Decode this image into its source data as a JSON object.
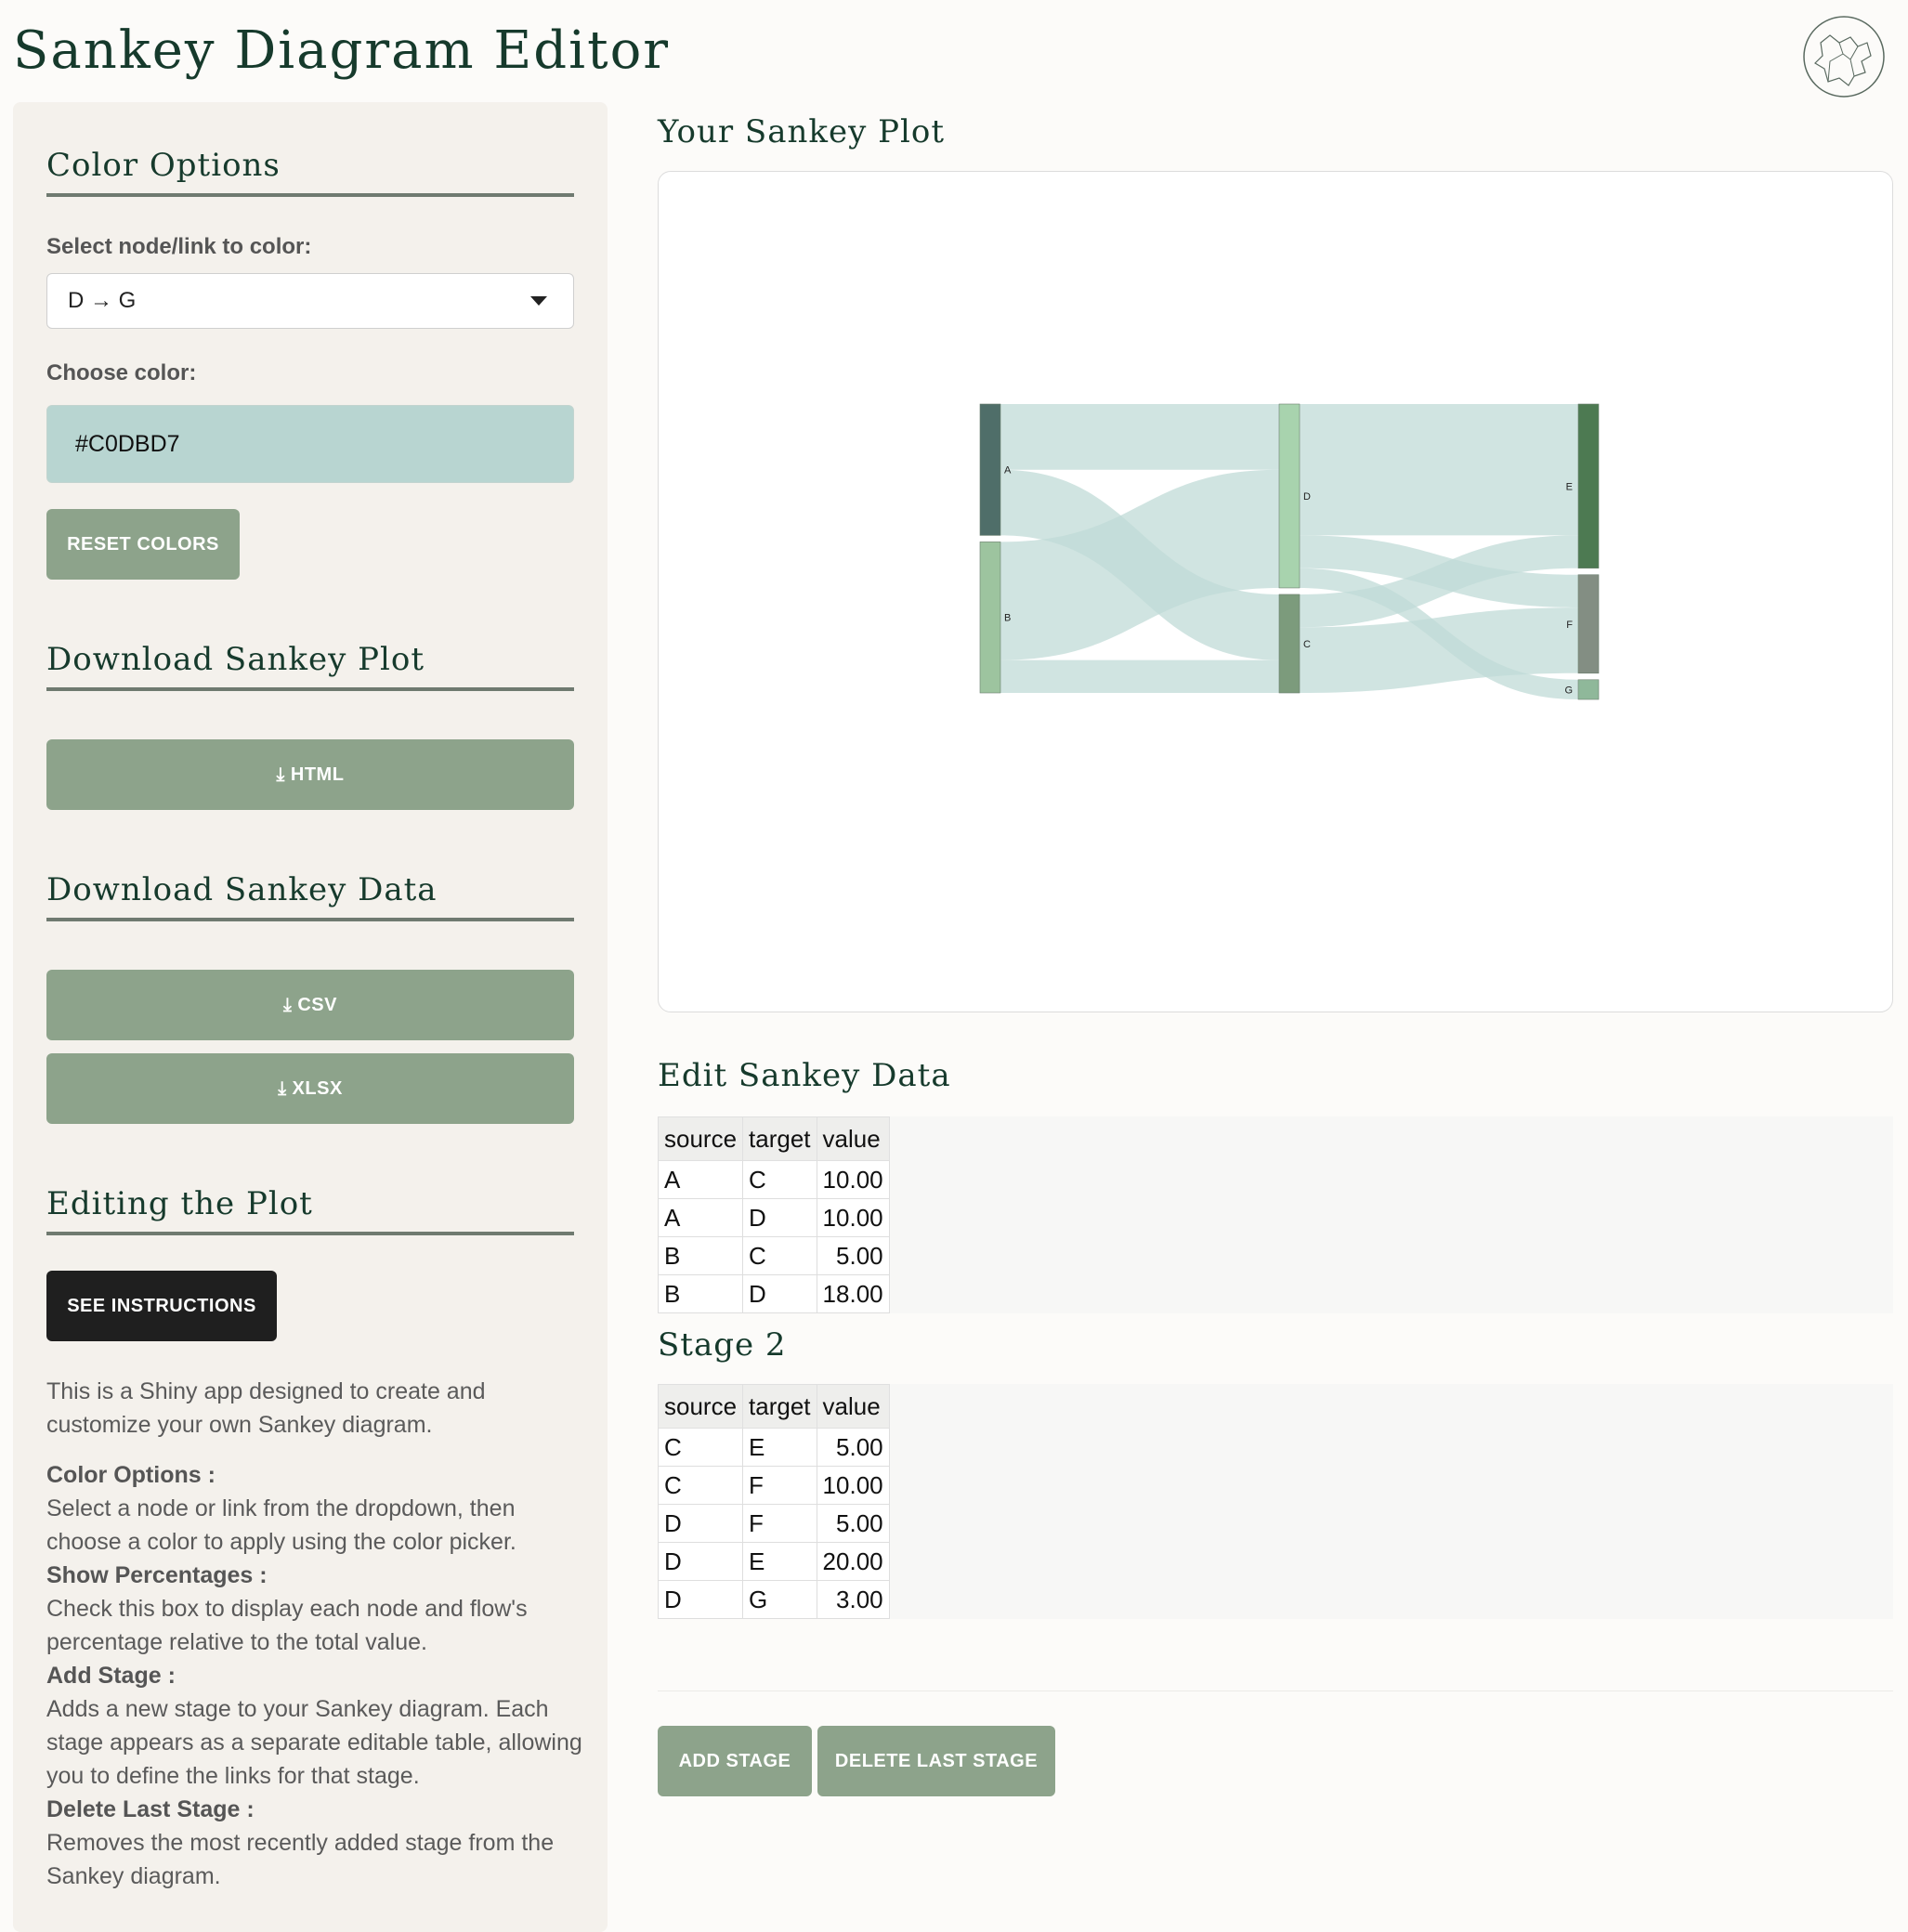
{
  "app": {
    "title": "Sankey Diagram Editor"
  },
  "sidebar": {
    "color_options": {
      "title": "Color Options",
      "select_label": "Select node/link to color:",
      "selected": "D → G",
      "color_label": "Choose color:",
      "color_value": "#C0DBD7",
      "reset_label": "RESET COLORS"
    },
    "download_plot": {
      "title": "Download Sankey Plot",
      "html_label": "HTML"
    },
    "download_data": {
      "title": "Download Sankey Data",
      "csv_label": "CSV",
      "xlsx_label": "XLSX"
    },
    "editing": {
      "title": "Editing the Plot",
      "instructions_label": "SEE INSTRUCTIONS",
      "intro": "This is a Shiny app designed to create and customize your own Sankey diagram.",
      "items": [
        {
          "heading": "Color Options :",
          "body": "Select a node or link from the dropdown, then choose a color to apply using the color picker."
        },
        {
          "heading": "Show Percentages :",
          "body": "Check this box to display each node and flow's percentage relative to the total value."
        },
        {
          "heading": "Add Stage :",
          "body": "Adds a new stage to your Sankey diagram. Each stage appears as a separate editable table, allowing you to define the links for that stage."
        },
        {
          "heading": "Delete Last Stage :",
          "body": "Removes the most recently added stage from the Sankey diagram."
        }
      ]
    }
  },
  "main": {
    "plot_title": "Your Sankey Plot",
    "edit_title": "Edit Sankey Data",
    "columns": [
      "source",
      "target",
      "value"
    ],
    "stage1": [
      [
        "A",
        "C",
        "10.00"
      ],
      [
        "A",
        "D",
        "10.00"
      ],
      [
        "B",
        "C",
        "5.00"
      ],
      [
        "B",
        "D",
        "18.00"
      ]
    ],
    "stage2_title": "Stage 2",
    "stage2": [
      [
        "C",
        "E",
        "5.00"
      ],
      [
        "C",
        "F",
        "10.00"
      ],
      [
        "D",
        "F",
        "5.00"
      ],
      [
        "D",
        "E",
        "20.00"
      ],
      [
        "D",
        "G",
        "3.00"
      ]
    ],
    "add_stage_label": "ADD STAGE",
    "delete_stage_label": "DELETE LAST STAGE"
  },
  "sankey": {
    "link_color": "#C0DBD7",
    "nodes": [
      {
        "id": "A",
        "label": "A",
        "column": 0,
        "color": "#4f6e69"
      },
      {
        "id": "B",
        "label": "B",
        "column": 0,
        "color": "#9dc49f"
      },
      {
        "id": "D",
        "label": "D",
        "column": 1,
        "color": "#a8d3ae"
      },
      {
        "id": "C",
        "label": "C",
        "column": 1,
        "color": "#7c9b7c"
      },
      {
        "id": "E",
        "label": "E",
        "column": 2,
        "color": "#4d7a52"
      },
      {
        "id": "F",
        "label": "F",
        "column": 2,
        "color": "#838e83"
      },
      {
        "id": "G",
        "label": "G",
        "column": 2,
        "color": "#8fb89a"
      }
    ],
    "links": [
      {
        "source": "A",
        "target": "C",
        "value": 10
      },
      {
        "source": "A",
        "target": "D",
        "value": 10
      },
      {
        "source": "B",
        "target": "C",
        "value": 5
      },
      {
        "source": "B",
        "target": "D",
        "value": 18
      },
      {
        "source": "C",
        "target": "E",
        "value": 5
      },
      {
        "source": "C",
        "target": "F",
        "value": 10
      },
      {
        "source": "D",
        "target": "F",
        "value": 5
      },
      {
        "source": "D",
        "target": "E",
        "value": 20
      },
      {
        "source": "D",
        "target": "G",
        "value": 3
      }
    ]
  }
}
